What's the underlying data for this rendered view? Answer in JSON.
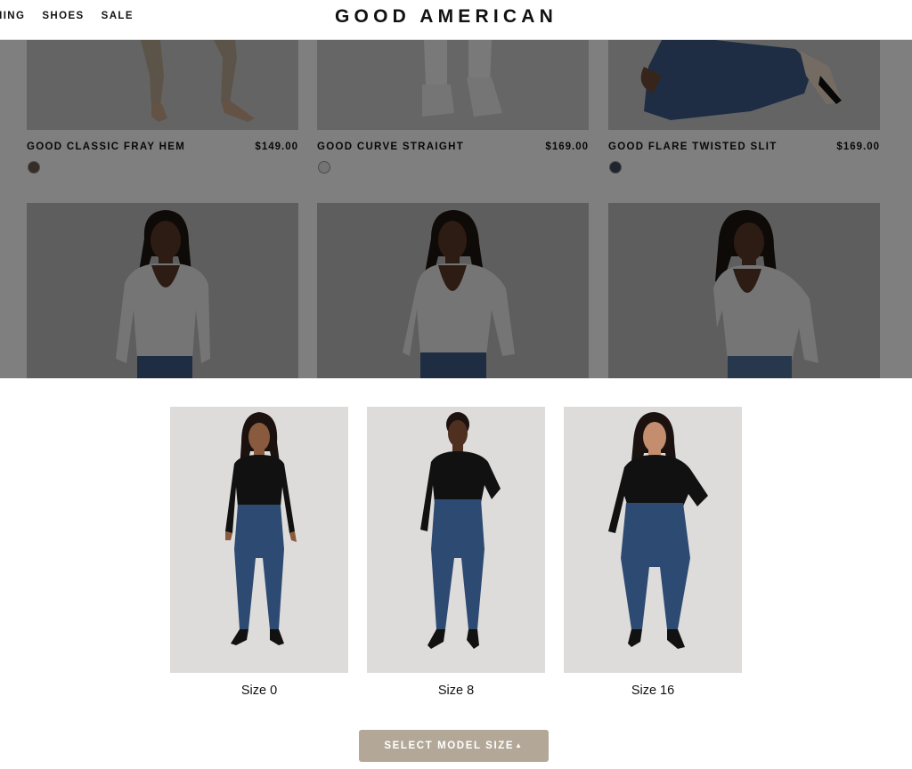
{
  "header": {
    "nav": [
      "HING",
      "SHOES",
      "SALE"
    ],
    "logo": "GOOD AMERICAN"
  },
  "products": [
    {
      "name": "GOOD CLASSIC FRAY HEM",
      "price": "$149.00",
      "swatch_color": "#6b5a4e"
    },
    {
      "name": "GOOD CURVE STRAIGHT",
      "price": "$169.00",
      "swatch_color": "#e9e9e9"
    },
    {
      "name": "GOOD FLARE TWISTED SLIT",
      "price": "$169.00",
      "swatch_color": "#3d4a5c"
    }
  ],
  "model_sizes": {
    "options": [
      {
        "label": "Size 0"
      },
      {
        "label": "Size 8"
      },
      {
        "label": "Size 16"
      }
    ],
    "button_label": "SELECT MODEL SIZE",
    "button_icon": "caret-up-icon"
  },
  "colors": {
    "button_bg": "#b3a898",
    "overlay": "rgba(0,0,0,0.5)",
    "denim": "#2d4a72"
  }
}
